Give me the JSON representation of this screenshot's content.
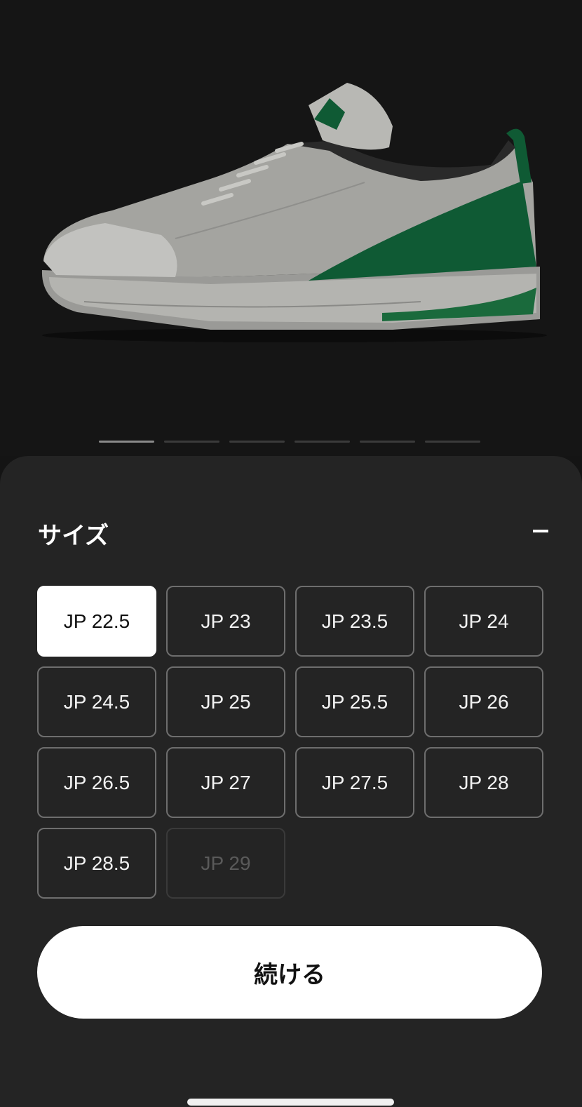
{
  "carousel": {
    "total": 6,
    "active_index": 0
  },
  "size_panel": {
    "title": "サイズ",
    "collapse_icon": "minus-icon",
    "sizes": [
      {
        "label": "JP 22.5",
        "state": "selected"
      },
      {
        "label": "JP 23",
        "state": "available"
      },
      {
        "label": "JP 23.5",
        "state": "available"
      },
      {
        "label": "JP 24",
        "state": "available"
      },
      {
        "label": "JP 24.5",
        "state": "available"
      },
      {
        "label": "JP 25",
        "state": "available"
      },
      {
        "label": "JP 25.5",
        "state": "available"
      },
      {
        "label": "JP 26",
        "state": "available"
      },
      {
        "label": "JP 26.5",
        "state": "available"
      },
      {
        "label": "JP 27",
        "state": "available"
      },
      {
        "label": "JP 27.5",
        "state": "available"
      },
      {
        "label": "JP 28",
        "state": "available"
      },
      {
        "label": "JP 28.5",
        "state": "available"
      },
      {
        "label": "JP 29",
        "state": "unavailable"
      }
    ],
    "continue_label": "続ける"
  },
  "colors": {
    "accent_green": "#0f5a34",
    "sheet_bg": "#242424"
  }
}
